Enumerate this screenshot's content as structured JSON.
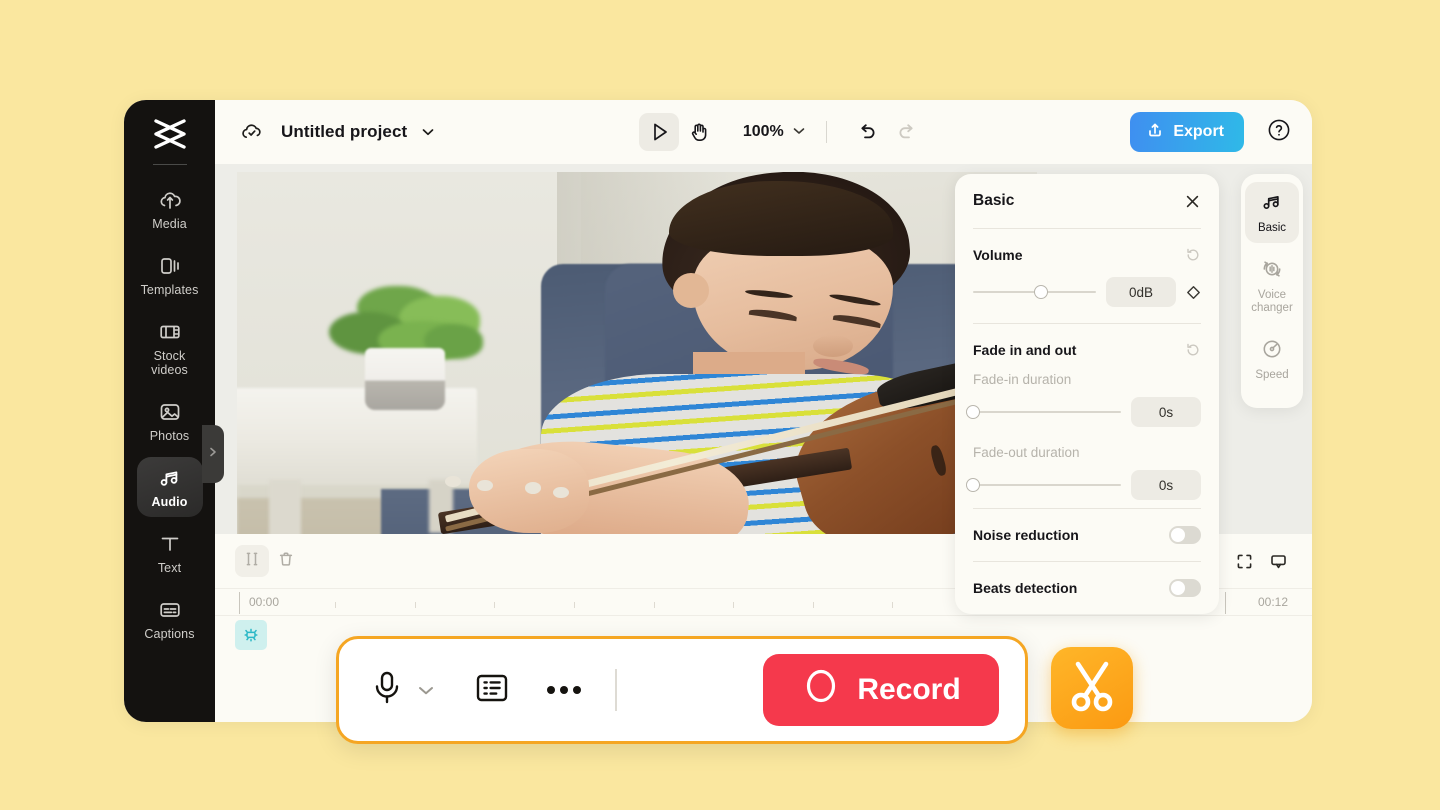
{
  "theme": {
    "page_bg": "#FAE79F",
    "app_bg": "#FCFBF5",
    "rail_bg": "#141210",
    "accent_export": "#3F8FF0",
    "accent_record": "#F5394C",
    "accent_highlight": "#F5A623",
    "stage_bg": "#EDEDE8"
  },
  "sidebar": {
    "logo_name": "capcut-logo",
    "items": [
      {
        "label": "Media",
        "icon": "cloud-upload-icon",
        "active": false
      },
      {
        "label": "Templates",
        "icon": "templates-icon",
        "active": false
      },
      {
        "label": "Stock videos",
        "icon": "film-strip-icon",
        "active": false
      },
      {
        "label": "Photos",
        "icon": "photo-icon",
        "active": false
      },
      {
        "label": "Audio",
        "icon": "music-note-icon",
        "active": true
      },
      {
        "label": "Text",
        "icon": "text-t-icon",
        "active": false
      },
      {
        "label": "Captions",
        "icon": "captions-icon",
        "active": false
      }
    ],
    "collapse_icon": "chevron-right-icon"
  },
  "topbar": {
    "cloud_icon": "cloud-check-icon",
    "project_name": "Untitled project",
    "project_caret_icon": "chevron-down-icon",
    "select_tool_icon": "cursor-arrow-icon",
    "hand_tool_icon": "hand-icon",
    "zoom_level": "100%",
    "zoom_caret_icon": "chevron-down-icon",
    "undo_icon": "undo-icon",
    "redo_icon": "redo-icon",
    "export_label": "Export",
    "export_icon": "share-upload-icon",
    "help_icon": "question-circle-icon"
  },
  "properties_panel": {
    "title": "Basic",
    "close_icon": "close-icon",
    "volume": {
      "label": "Volume",
      "reset_icon": "reset-icon",
      "value": "0dB",
      "slider_percent": 55,
      "keyframe_icon": "diamond-keyframe-icon"
    },
    "fade": {
      "label": "Fade in and out",
      "reset_icon": "reset-icon",
      "fade_in_label": "Fade-in duration",
      "fade_in_value": "0s",
      "fade_in_percent": 0,
      "fade_out_label": "Fade-out duration",
      "fade_out_value": "0s",
      "fade_out_percent": 0
    },
    "noise_reduction": {
      "label": "Noise reduction",
      "enabled": false
    },
    "beats_detection": {
      "label": "Beats detection",
      "enabled": false
    }
  },
  "tab_rail": {
    "items": [
      {
        "label": "Basic",
        "icon": "music-note-icon",
        "active": true
      },
      {
        "label": "Voice\nchanger",
        "label_line1": "Voice",
        "label_line2": "changer",
        "icon": "voice-changer-icon",
        "active": false
      },
      {
        "label": "Speed",
        "icon": "speedometer-icon",
        "active": false
      }
    ]
  },
  "timeline": {
    "split_icon": "split-clip-icon",
    "delete_icon": "trash-icon",
    "zoom_out_icon": "minus-icon",
    "zoom_in_icon": "plus-circle-icon",
    "fit_icon": "fit-screen-icon",
    "preview_icon": "preview-monitor-icon",
    "time_start": "00:00",
    "time_end": "00:12",
    "ai_chip_icon": "ai-sparkle-icon"
  },
  "record_bar": {
    "mic_icon": "microphone-icon",
    "mic_caret_icon": "chevron-down-icon",
    "list_icon": "list-panel-icon",
    "more_icon": "more-horizontal-icon",
    "record_label": "Record",
    "record_circle_icon": "record-circle-icon"
  },
  "scissors_fab": {
    "icon": "scissors-icon"
  },
  "preview": {
    "alt": "boy-playing-violin-video-frame"
  }
}
